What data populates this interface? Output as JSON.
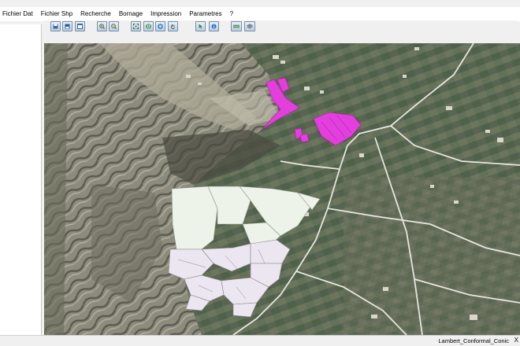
{
  "menu": {
    "items": [
      "Fichier Dat",
      "Fichier Shp",
      "Recherche",
      "Bornage",
      "Impression",
      "Parametres",
      "?"
    ]
  },
  "toolbar": {
    "buttons": [
      {
        "name": "save-icon"
      },
      {
        "name": "save-as-icon"
      },
      {
        "name": "window-icon"
      },
      {
        "name": "zoom-in-icon"
      },
      {
        "name": "zoom-out-icon"
      },
      {
        "name": "full-extent-icon"
      },
      {
        "name": "globe-icon"
      },
      {
        "name": "refresh-icon"
      },
      {
        "name": "pan-hand-icon"
      },
      {
        "name": "select-arrow-icon"
      },
      {
        "name": "info-icon"
      },
      {
        "name": "layer-icon"
      },
      {
        "name": "layers-stack-icon"
      }
    ]
  },
  "status": {
    "projection": "Lambert_Conformal_Conic",
    "close_glyph": "X"
  },
  "colors": {
    "parcel_magenta": "#e23fdc",
    "parcel_pale_green": "#edf3e9",
    "parcel_pale_lavender": "#ece6f0",
    "road": "#e8e6df"
  }
}
